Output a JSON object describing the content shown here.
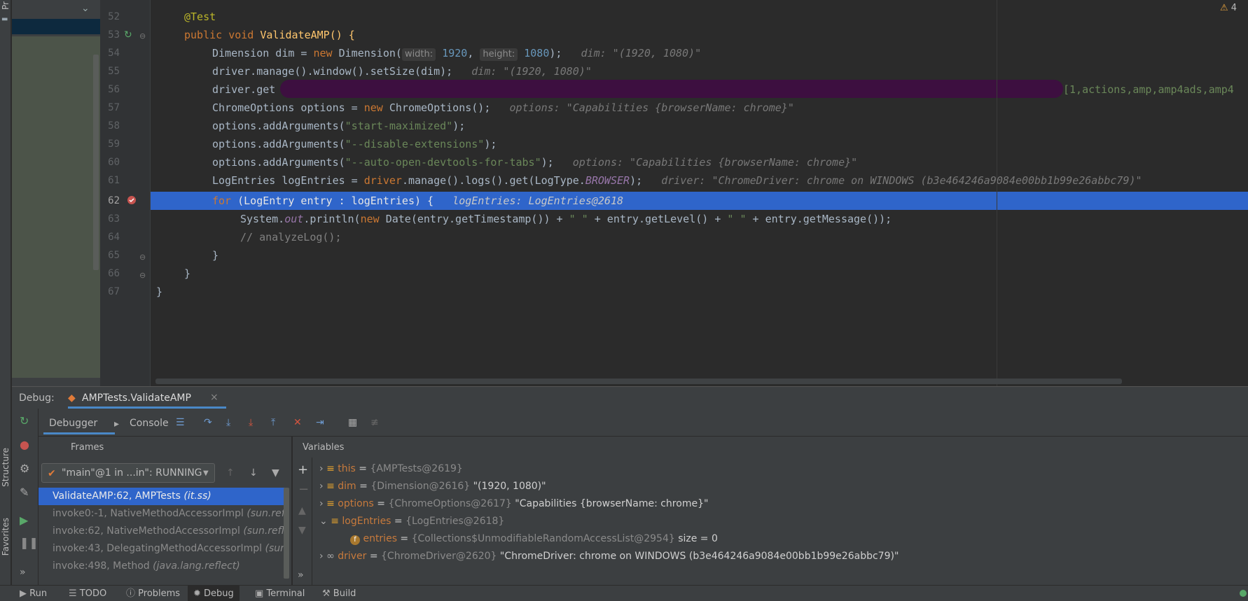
{
  "left_strip": {
    "project_label": "Pr",
    "structure_label": "Structure",
    "favorites_label": "Favorites"
  },
  "editor": {
    "line_numbers": [
      "52",
      "53",
      "54",
      "55",
      "56",
      "57",
      "58",
      "59",
      "60",
      "61",
      "62",
      "63",
      "64",
      "65",
      "66",
      "67"
    ],
    "warnings_count": "4",
    "lines": {
      "l52": "@Test",
      "l53_kw": "public void ",
      "l53_name": "ValidateAMP() {",
      "l54_a": "Dimension dim = ",
      "l54_new": "new ",
      "l54_b": "Dimension(",
      "l54_hw": "width:",
      "l54_w": "1920",
      "l54_comma": ", ",
      "l54_hh": "height:",
      "l54_h": "1080",
      "l54_end": ");",
      "l54_inline": "dim: \"(1920, 1080)\"",
      "l55": "driver.manage().window().setSize(dim);",
      "l55_inline": "dim: \"(1920, 1080)\"",
      "l56_a": "driver.get",
      "l56_tail": "[1,actions,amp,amp4ads,amp4",
      "l57_a": "ChromeOptions options = ",
      "l57_new": "new ",
      "l57_b": "ChromeOptions();",
      "l57_inline": "options: \"Capabilities {browserName: chrome}\"",
      "l58_a": "options.addArguments(",
      "l58_s": "\"start-maximized\"",
      "l58_e": ");",
      "l59_a": "options.addArguments(",
      "l59_s": "\"--disable-extensions\"",
      "l59_e": ");",
      "l60_a": "options.addArguments(",
      "l60_s": "\"--auto-open-devtools-for-tabs\"",
      "l60_e": ");",
      "l60_inline": "options: \"Capabilities {browserName: chrome}\"",
      "l61_a": "LogEntries logEntries = ",
      "l61_drv": "driver",
      "l61_b": ".manage().logs().get(LogType.",
      "l61_fld": "BROWSER",
      "l61_e": ");",
      "l61_inline": "driver: \"ChromeDriver: chrome on WINDOWS (b3e464246a9084e00bb1b99e26abbc79)\"",
      "l62_kw": "for ",
      "l62_b": "(LogEntry entry : logEntries) {",
      "l62_inline": "logEntries: LogEntries@2618",
      "l63_a": "System.",
      "l63_out": "out",
      "l63_b": ".println(",
      "l63_new": "new ",
      "l63_c": "Date(entry.getTimestamp()) + ",
      "l63_s1": "\" \"",
      "l63_d": " + entry.getLevel() + ",
      "l63_s2": "\" \"",
      "l63_e": " + entry.getMessage());",
      "l64": "// analyzeLog();",
      "l65": "}",
      "l66": "}",
      "l67": "}"
    }
  },
  "debug": {
    "label": "Debug:",
    "session_tab": "AMPTests.ValidateAMP",
    "close": "×",
    "tabs": {
      "debugger": "Debugger",
      "console": "Console"
    },
    "frames_title": "Frames",
    "variables_title": "Variables",
    "thread_select": "\"main\"@1 in ...in\": RUNNING",
    "frames": [
      {
        "method": "ValidateAMP:62, AMPTests ",
        "pkg": "(it.ss)"
      },
      {
        "method": "invoke0:-1, NativeMethodAccessorImpl ",
        "pkg": "(sun.reflect)"
      },
      {
        "method": "invoke:62, NativeMethodAccessorImpl ",
        "pkg": "(sun.reflect)"
      },
      {
        "method": "invoke:43, DelegatingMethodAccessorImpl ",
        "pkg": "(sun.refle"
      },
      {
        "method": "invoke:498, Method ",
        "pkg": "(java.lang.reflect)"
      }
    ],
    "variables": [
      {
        "name": "this",
        "eq": " = ",
        "type": "{AMPTests@2619}",
        "value": ""
      },
      {
        "name": "dim",
        "eq": " = ",
        "type": "{Dimension@2616}",
        "value": " \"(1920, 1080)\""
      },
      {
        "name": "options",
        "eq": " = ",
        "type": "{ChromeOptions@2617}",
        "value": " \"Capabilities {browserName: chrome}\""
      },
      {
        "name": "logEntries",
        "eq": " = ",
        "type": "{LogEntries@2618}",
        "value": ""
      },
      {
        "name": "entries",
        "eq": " = ",
        "type": "{Collections$UnmodifiableRandomAccessList@2954}",
        "value": "  size = 0"
      },
      {
        "name": "driver",
        "eq": " = ",
        "type": "{ChromeDriver@2620}",
        "value": " \"ChromeDriver: chrome on WINDOWS (b3e464246a9084e00bb1b99e26abbc79)\""
      }
    ]
  },
  "status_tabs": {
    "run": "Run",
    "todo": "TODO",
    "problems": "Problems",
    "debug": "Debug",
    "terminal": "Terminal",
    "build": "Build"
  },
  "colors": {
    "selection": "#2f65ca",
    "keyword": "#cc7832",
    "string": "#6a8759",
    "number": "#6897bb",
    "annotation": "#bbb529"
  }
}
